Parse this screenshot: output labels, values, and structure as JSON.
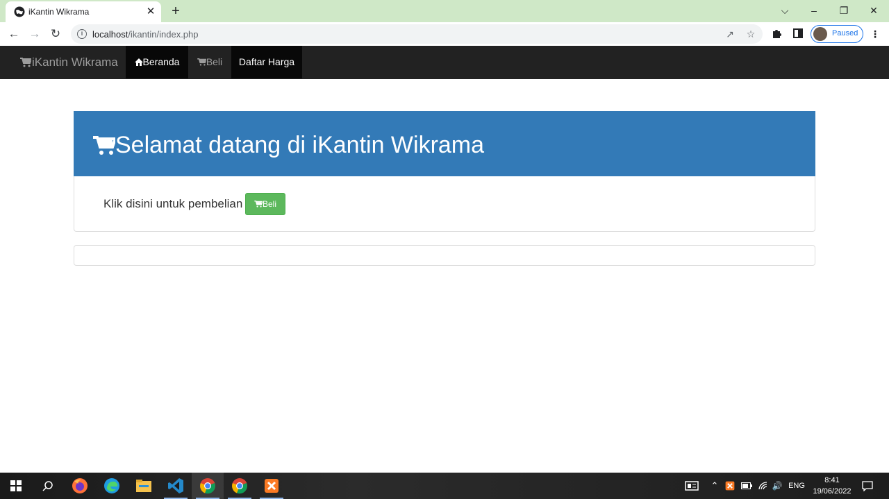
{
  "browser": {
    "tab_title": "iKantin Wikrama",
    "tab_close": "✕",
    "new_tab": "+",
    "url_host": "localhost",
    "url_path": "/ikantin/index.php",
    "profile_status": "Paused",
    "win_min": "–",
    "win_restore": "❐",
    "win_close": "✕",
    "collapse": "⌵"
  },
  "navbar": {
    "brand": "iKantin Wikrama",
    "items": [
      {
        "label": "Beranda",
        "icon": "home-icon",
        "active": true
      },
      {
        "label": "Beli",
        "icon": "cart-icon",
        "active": false
      },
      {
        "label": "Daftar Harga",
        "icon": null,
        "active": true
      }
    ]
  },
  "main": {
    "welcome_title": "Selamat datang di iKantin Wikrama",
    "purchase_text": "Klik disini untuk pembelian",
    "buy_button": "Beli"
  },
  "taskbar": {
    "lang": "ENG",
    "time": "8:41",
    "date": "19/06/2022"
  },
  "colors": {
    "navbar_bg": "#222222",
    "jumbotron_bg": "#337ab7",
    "button_success": "#5cb85c",
    "tabstrip_bg": "#cfe8c7"
  }
}
